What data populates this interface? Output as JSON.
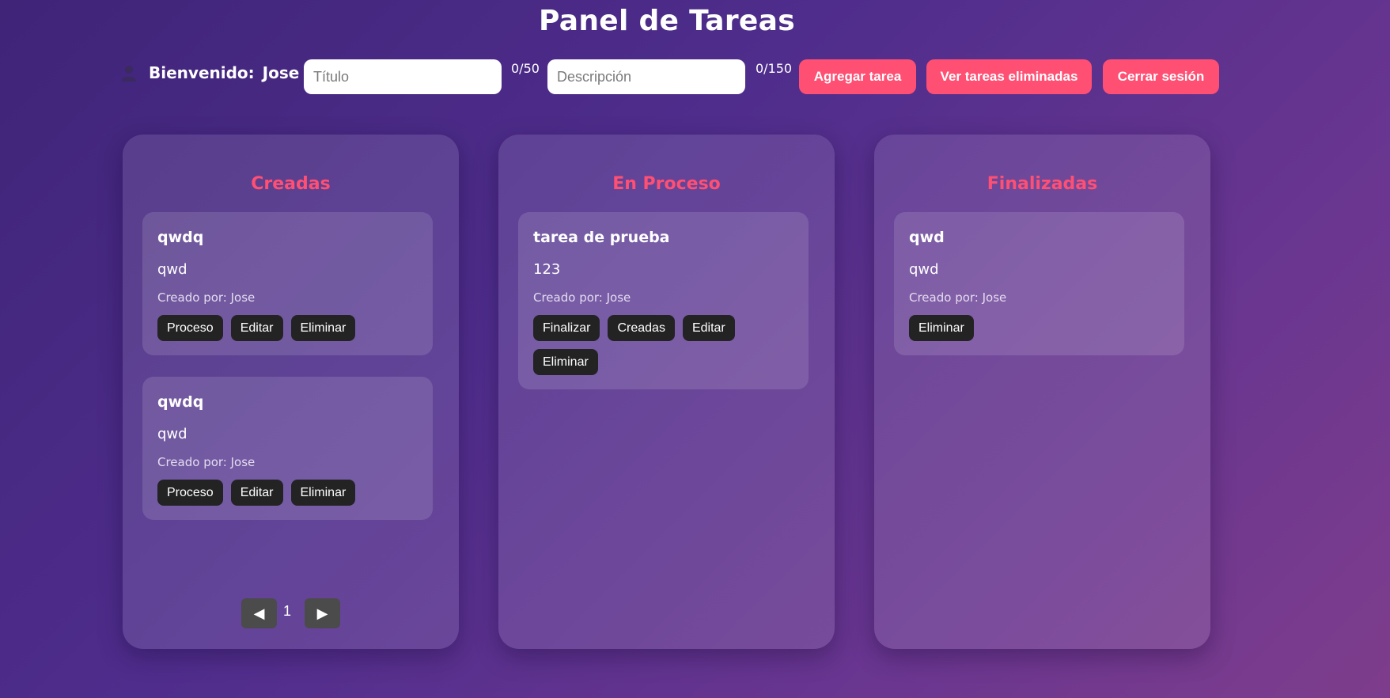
{
  "header": {
    "title": "Panel de Tareas",
    "welcome_label": "Bienvenido:",
    "user_name": "Jose",
    "title_placeholder": "Título",
    "title_counter": "0/50",
    "desc_placeholder": "Descripción",
    "desc_counter": "0/150",
    "add_label": "Agregar tarea",
    "deleted_label": "Ver tareas eliminadas",
    "logout_label": "Cerrar sesión"
  },
  "columns": {
    "created": {
      "title": "Creadas",
      "tasks": [
        {
          "title": "qwdq",
          "description": "qwd",
          "author": "Creado por: Jose",
          "buttons": [
            "Proceso",
            "Editar",
            "Eliminar"
          ]
        },
        {
          "title": "qwdq",
          "description": "qwd",
          "author": "Creado por: Jose",
          "buttons": [
            "Proceso",
            "Editar",
            "Eliminar"
          ]
        }
      ],
      "pagination": {
        "prev": "◀",
        "page": "1",
        "next": "▶"
      }
    },
    "process": {
      "title": "En Proceso",
      "tasks": [
        {
          "title": "tarea de prueba",
          "description": "123",
          "author": "Creado por: Jose",
          "buttons": [
            "Finalizar",
            "Creadas",
            "Editar",
            "Eliminar"
          ]
        }
      ]
    },
    "done": {
      "title": "Finalizadas",
      "tasks": [
        {
          "title": "qwd",
          "description": "qwd",
          "author": "Creado por: Jose",
          "buttons": [
            "Eliminar"
          ]
        }
      ]
    }
  },
  "colors": {
    "accent": "#ff4f73",
    "task_button": "#232323",
    "pager_button": "#4b4b4b"
  },
  "icons": {
    "avatar": "user-silhouette-icon"
  }
}
